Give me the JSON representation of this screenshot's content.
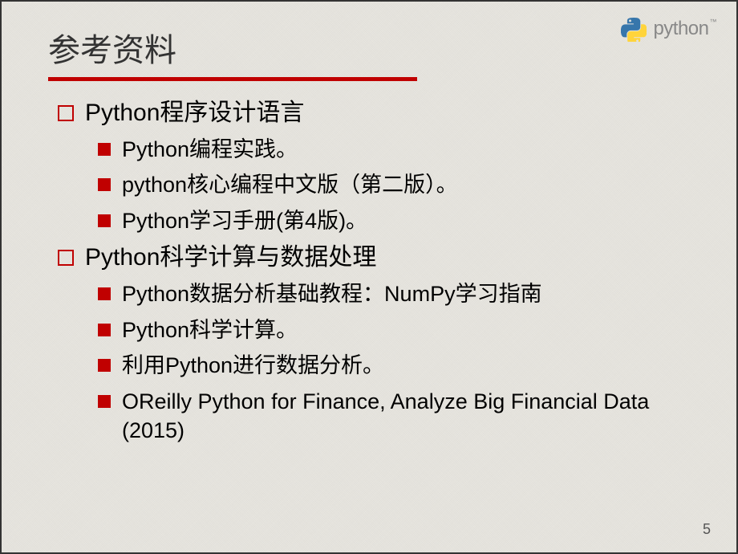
{
  "logo": {
    "text": "python",
    "tm": "™"
  },
  "title": "参考资料",
  "sections": [
    {
      "heading": "Python程序设计语言",
      "items": [
        "Python编程实践。",
        "python核心编程中文版（第二版）。",
        "Python学习手册(第4版)。"
      ]
    },
    {
      "heading": "Python科学计算与数据处理",
      "items": [
        "Python数据分析基础教程：NumPy学习指南",
        "Python科学计算。",
        "利用Python进行数据分析。",
        "OReilly Python for Finance, Analyze Big Financial Data (2015)"
      ]
    }
  ],
  "pageNumber": "5"
}
